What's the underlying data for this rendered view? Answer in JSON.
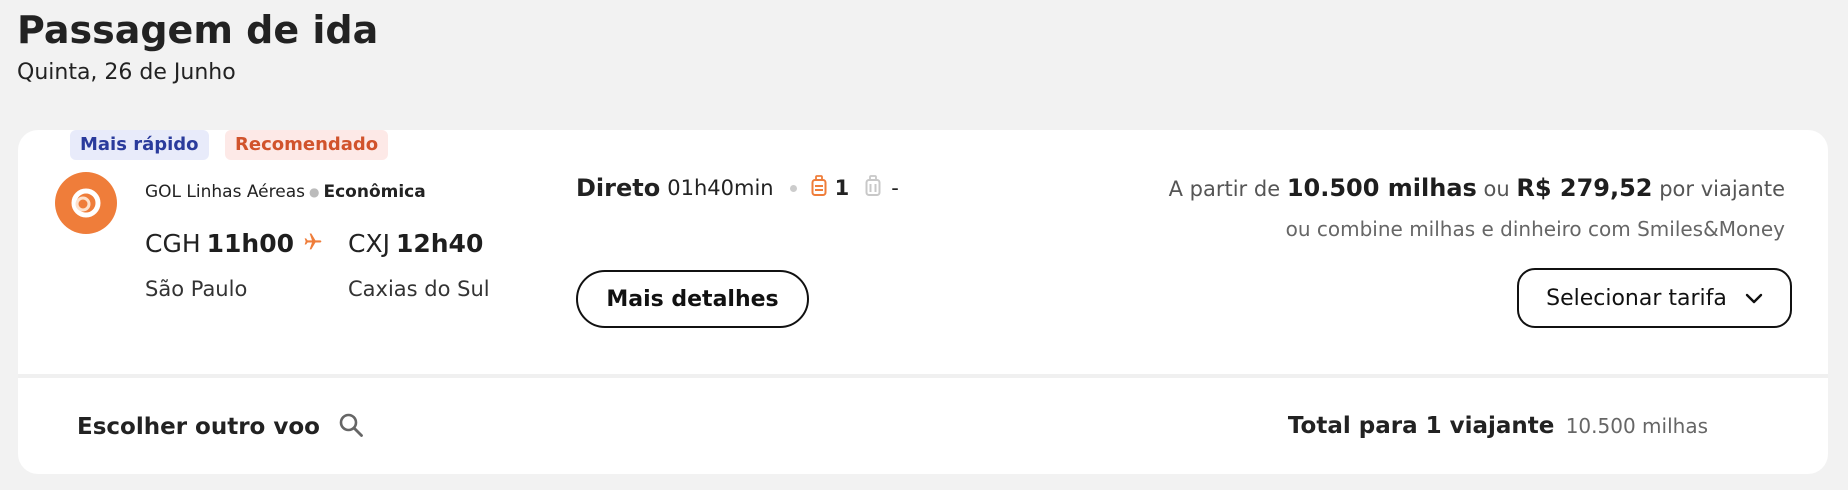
{
  "header": {
    "title": "Passagem de ida",
    "date": "Quinta, 26 de Junho"
  },
  "flight": {
    "badges": {
      "fastest": "Mais rápido",
      "recommended": "Recomendado"
    },
    "airline": "GOL Linhas Aéreas",
    "cabin": "Econômica",
    "departure": {
      "code": "CGH",
      "time": "11h00",
      "city": "São Paulo"
    },
    "arrival": {
      "code": "CXJ",
      "time": "12h40",
      "city": "Caxias do Sul"
    },
    "stops": "Direto",
    "duration": "01h40min",
    "checked_bags": "1",
    "hand_bags": "-",
    "details_button": "Mais detalhes",
    "price": {
      "prefix": "A partir de",
      "miles": "10.500 milhas",
      "or": "ou",
      "money": "R$ 279,52",
      "suffix": "por viajante",
      "combine": "ou combine milhas e dinheiro com Smiles&Money"
    },
    "select_button": "Selecionar tarifa"
  },
  "footer": {
    "other_flight": "Escolher outro voo",
    "total_label": "Total para 1 viajante",
    "total_value": "10.500 milhas"
  },
  "colors": {
    "accent": "#ef7d3a",
    "badge_fast_text": "#2a3b9c",
    "badge_rec_text": "#d1532c"
  },
  "icons": [
    "airline-logo",
    "plane-icon",
    "checked-bag-icon",
    "hand-bag-icon",
    "chevron-down-icon",
    "search-icon"
  ]
}
